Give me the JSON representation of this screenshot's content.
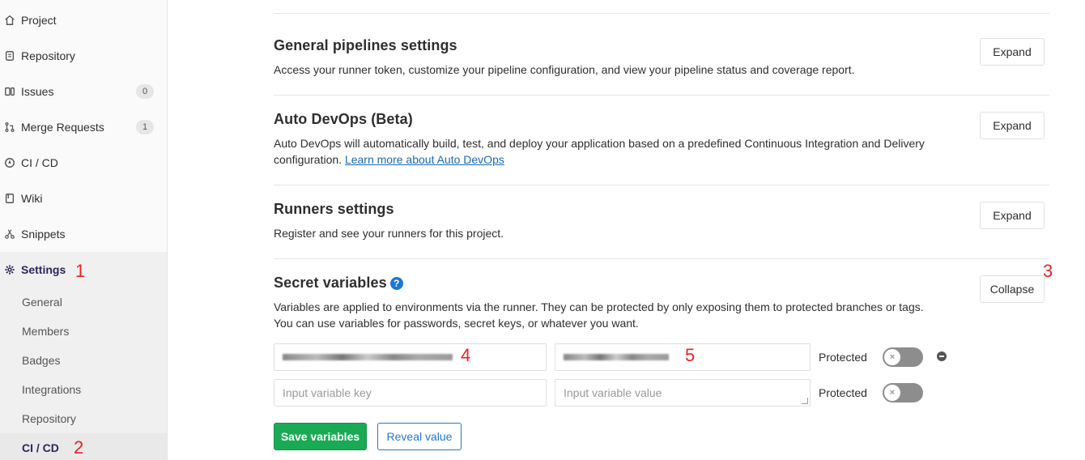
{
  "sidebar": {
    "items": [
      {
        "label": "Project",
        "icon": "home-icon"
      },
      {
        "label": "Repository",
        "icon": "document-icon"
      },
      {
        "label": "Issues",
        "icon": "issues-icon",
        "count": "0"
      },
      {
        "label": "Merge Requests",
        "icon": "merge-request-icon",
        "count": "1"
      },
      {
        "label": "CI / CD",
        "icon": "rocket-icon"
      },
      {
        "label": "Wiki",
        "icon": "book-icon"
      },
      {
        "label": "Snippets",
        "icon": "scissors-icon"
      },
      {
        "label": "Settings",
        "icon": "gear-icon"
      }
    ],
    "settings_sub": [
      {
        "label": "General"
      },
      {
        "label": "Members"
      },
      {
        "label": "Badges"
      },
      {
        "label": "Integrations"
      },
      {
        "label": "Repository"
      },
      {
        "label": "CI / CD"
      }
    ]
  },
  "annotations": {
    "a1": "1",
    "a2": "2",
    "a3": "3",
    "a4": "4",
    "a5": "5"
  },
  "sections": {
    "general": {
      "title": "General pipelines settings",
      "desc": "Access your runner token, customize your pipeline configuration, and view your pipeline status and coverage report.",
      "button": "Expand"
    },
    "autodevops": {
      "title": "Auto DevOps (Beta)",
      "desc_line1": "Auto DevOps will automatically build, test, and deploy your application based on a predefined Continuous Integration and Delivery",
      "desc_prefix": "configuration. ",
      "link": "Learn more about Auto DevOps",
      "button": "Expand"
    },
    "runners": {
      "title": "Runners settings",
      "desc": "Register and see your runners for this project.",
      "button": "Expand"
    },
    "secret": {
      "title": "Secret variables",
      "help_icon": "question-circle-icon",
      "desc_line1": "Variables are applied to environments via the runner. They can be protected by only exposing them to protected branches or tags.",
      "desc_line2": "You can use variables for passwords, secret keys, or whatever you want.",
      "button": "Collapse",
      "key_placeholder": "Input variable key",
      "value_placeholder": "Input variable value",
      "protected_label": "Protected",
      "save_button": "Save variables",
      "reveal_button": "Reveal value"
    }
  },
  "colors": {
    "save_green": "#1aaa55",
    "link_blue": "#1f78d1",
    "annotation_red": "#e82323",
    "sidebar_active": "#2b2659"
  }
}
